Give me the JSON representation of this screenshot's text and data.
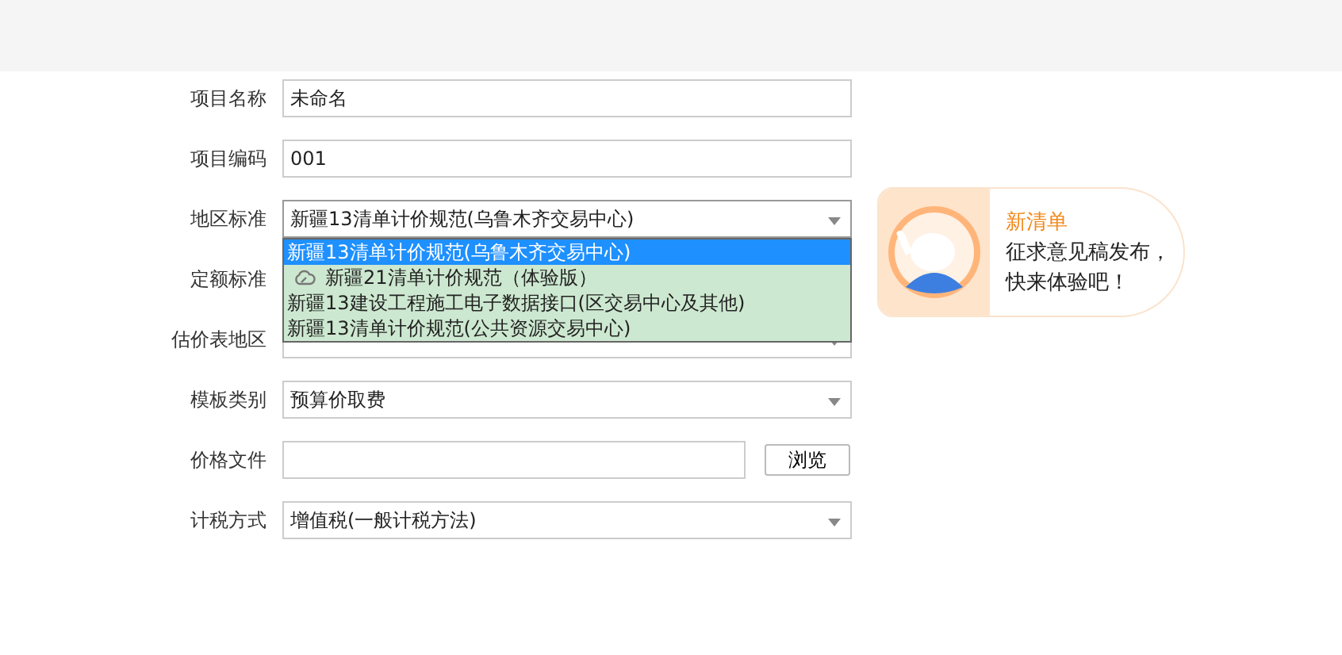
{
  "fields": [
    {
      "label": "项目名称",
      "kind": "text",
      "value": "未命名"
    },
    {
      "label": "项目编码",
      "kind": "text",
      "value": "001"
    },
    {
      "label": "地区标准",
      "kind": "select",
      "value": "新疆13清单计价规范(乌鲁木齐交易中心)",
      "expanded": true,
      "options": [
        {
          "text": "新疆13清单计价规范(乌鲁木齐交易中心)",
          "selected": true,
          "cloud": false
        },
        {
          "text": "新疆21清单计价规范（体验版）",
          "selected": false,
          "cloud": true
        },
        {
          "text": "新疆13建设工程施工电子数据接口(区交易中心及其他)",
          "selected": false,
          "cloud": false
        },
        {
          "text": "新疆13清单计价规范(公共资源交易中心)",
          "selected": false,
          "cloud": false
        }
      ]
    },
    {
      "label": "定额标准",
      "kind": "covered"
    },
    {
      "label": "估价表地区",
      "kind": "select"
    },
    {
      "label": "模板类别",
      "kind": "select",
      "value": "预算价取费"
    },
    {
      "label": "价格文件",
      "kind": "file",
      "button": "浏览"
    },
    {
      "label": "计税方式",
      "kind": "select",
      "value": "增值税(一般计税方法)"
    }
  ],
  "promo": {
    "title": "新清单",
    "lines": [
      "征求意见稿发布，",
      "快来体验吧！"
    ]
  }
}
